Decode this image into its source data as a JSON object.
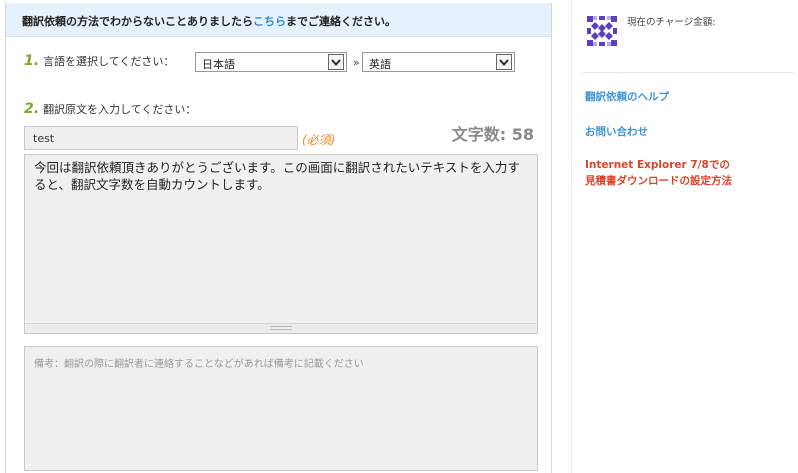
{
  "notice": {
    "before": "翻訳依頼の方法でわからないことありましたら",
    "link": "こちら",
    "after": "までご連絡ください。"
  },
  "step1": {
    "num": "1.",
    "label": "言語を選択してください："
  },
  "source_lang": {
    "selected": "日本語"
  },
  "separator": "»",
  "target_lang": {
    "selected": "英語"
  },
  "step2": {
    "num": "2.",
    "label": "翻訳原文を入力してください："
  },
  "title_field": {
    "value": "test"
  },
  "required_label": "(必須)",
  "char_count": {
    "label": "文字数:",
    "value": "58"
  },
  "source_text": {
    "value": "今回は翻訳依頼頂きありがとうございます。この画面に翻訳されたいテキストを入力すると、翻訳文字数を自動カウントします。"
  },
  "remarks": {
    "placeholder": "備考：翻訳の際に翻訳者に連絡することなどがあれば備考に記載ください"
  },
  "sidebar": {
    "charge_label": "現在のチャージ金額:",
    "help_link": "翻訳依頼のヘルプ",
    "contact_link": "お問い合わせ",
    "ie_link_line1": "Internet Explorer 7/8での",
    "ie_link_line2": "見積書ダウンロードの設定方法"
  },
  "colors": {
    "accent_blue": "#2f8fd0",
    "step_green": "#7ea82a",
    "required_orange": "#f08c2d",
    "warning_red": "#d8452a",
    "notice_bg": "#e7f1fb"
  },
  "icons": [
    "chevron-down-icon",
    "avatar-identicon"
  ]
}
